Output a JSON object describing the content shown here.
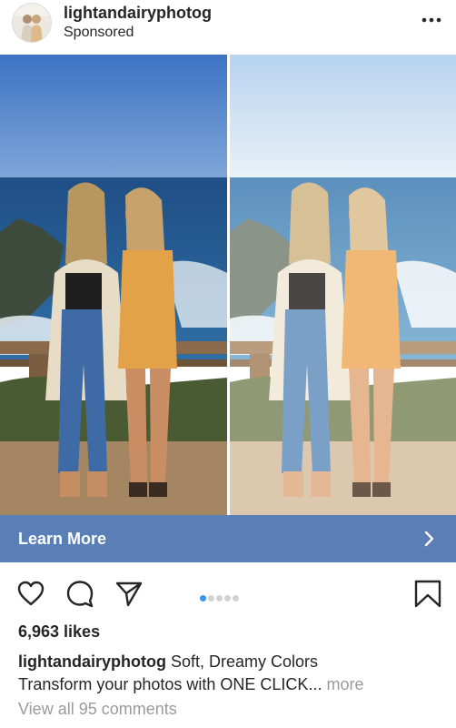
{
  "post": {
    "username": "lightandairyphotog",
    "sponsored_label": "Sponsored",
    "more_icon": "ellipsis-icon"
  },
  "cta": {
    "label": "Learn More",
    "icon": "chevron-right-icon",
    "color": "#5a7fb6"
  },
  "actions": {
    "like_icon": "heart-icon",
    "comment_icon": "comment-icon",
    "share_icon": "send-icon",
    "save_icon": "bookmark-icon",
    "carousel_total": 5,
    "carousel_active": 1,
    "active_dot_color": "#3897f0"
  },
  "likes": "6,963 likes",
  "caption": {
    "username": "lightandairyphotog",
    "line1": "Soft, Dreamy Colors",
    "line2": "Transform your photos with ONE CLICK...",
    "more": "more"
  },
  "comments_link": "View all 95 comments"
}
